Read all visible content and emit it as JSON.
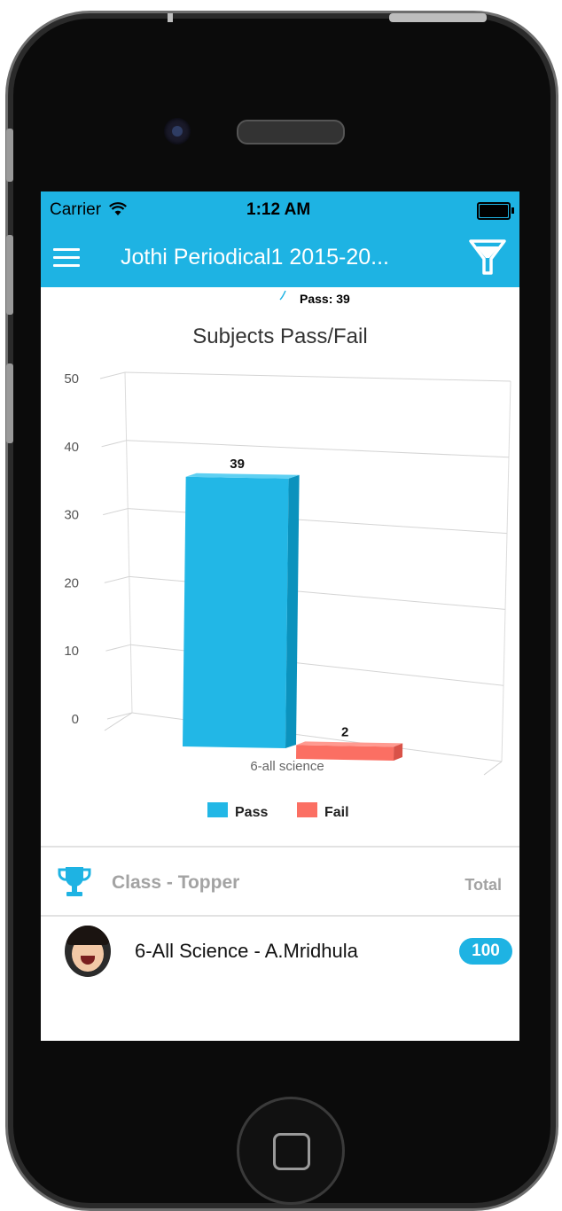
{
  "status_bar": {
    "carrier": "Carrier",
    "time": "1:12 AM"
  },
  "app_bar": {
    "title": "Jothi Periodical1 2015-20..."
  },
  "chart_data": {
    "type": "bar",
    "title": "Subjects Pass/Fail",
    "tooltip": "Pass: 39",
    "categories": [
      "6-all science"
    ],
    "series": [
      {
        "name": "Pass",
        "values": [
          39
        ],
        "color": "#22b7e6"
      },
      {
        "name": "Fail",
        "values": [
          2
        ],
        "color": "#fb6f63"
      }
    ],
    "ylim": [
      0,
      50
    ],
    "yticks": [
      "0",
      "10",
      "20",
      "30",
      "40",
      "50"
    ],
    "grid": true,
    "legend_position": "bottom"
  },
  "topper": {
    "header_label": "Class - Topper",
    "total_label": "Total",
    "rows": [
      {
        "name": "6-All Science - A.Mridhula",
        "total": "100"
      }
    ]
  },
  "colors": {
    "accent": "#1eb3e3"
  }
}
